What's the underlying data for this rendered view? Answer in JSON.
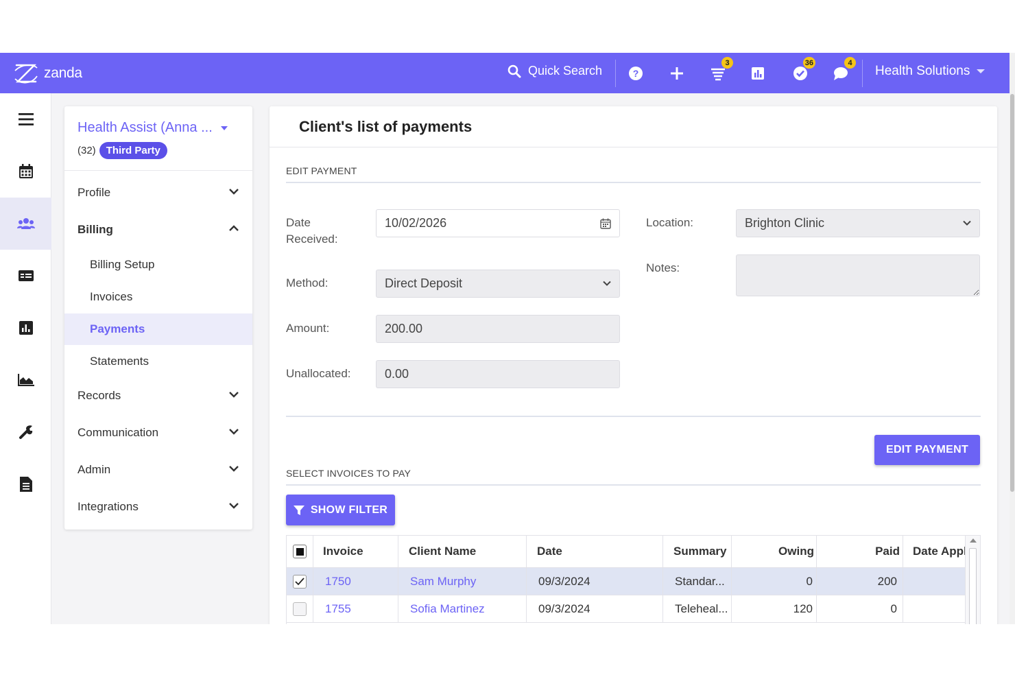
{
  "app": {
    "brand": "zanda"
  },
  "topbar": {
    "quick_search": "Quick Search",
    "badges": {
      "tasks": "3",
      "checks": "36",
      "messages": "4"
    },
    "org_name": "Health Solutions"
  },
  "client": {
    "name": "Health Assist (Anna ...",
    "count": "(32)",
    "tag": "Third Party"
  },
  "menu": {
    "profile": "Profile",
    "billing": "Billing",
    "billing_items": [
      "Billing Setup",
      "Invoices",
      "Payments",
      "Statements"
    ],
    "records": "Records",
    "communication": "Communication",
    "admin": "Admin",
    "integrations": "Integrations"
  },
  "main": {
    "title": "Client's list of payments",
    "edit_section": "EDIT PAYMENT",
    "date_label_1": "Date",
    "date_label_2": "Received:",
    "date_value": "10/02/2026",
    "method_label": "Method:",
    "method_value": "Direct Deposit",
    "amount_label": "Amount:",
    "amount_value": "200.00",
    "unallocated_label": "Unallocated:",
    "unallocated_value": "0.00",
    "location_label": "Location:",
    "location_value": "Brighton Clinic",
    "notes_label": "Notes:",
    "notes_value": "",
    "edit_button": "EDIT PAYMENT",
    "invoices_section": "SELECT INVOICES TO PAY",
    "filter_button": "SHOW FILTER"
  },
  "table": {
    "headers": [
      "Invoice",
      "Client Name",
      "Date",
      "Summary",
      "Owing",
      "Paid",
      "Date Appl"
    ],
    "rows": [
      {
        "invoice": "1750",
        "client": "Sam Murphy",
        "date": "09/3/2024",
        "summary": "Standar...",
        "owing": "0",
        "paid": "200",
        "checked": true
      },
      {
        "invoice": "1755",
        "client": "Sofia Martinez",
        "date": "09/3/2024",
        "summary": "Teleheal...",
        "owing": "120",
        "paid": "0",
        "checked": false
      }
    ]
  },
  "colors": {
    "accent": "#6c63f5",
    "badge": "#f5c518",
    "selected_row": "#dfe4f3"
  }
}
